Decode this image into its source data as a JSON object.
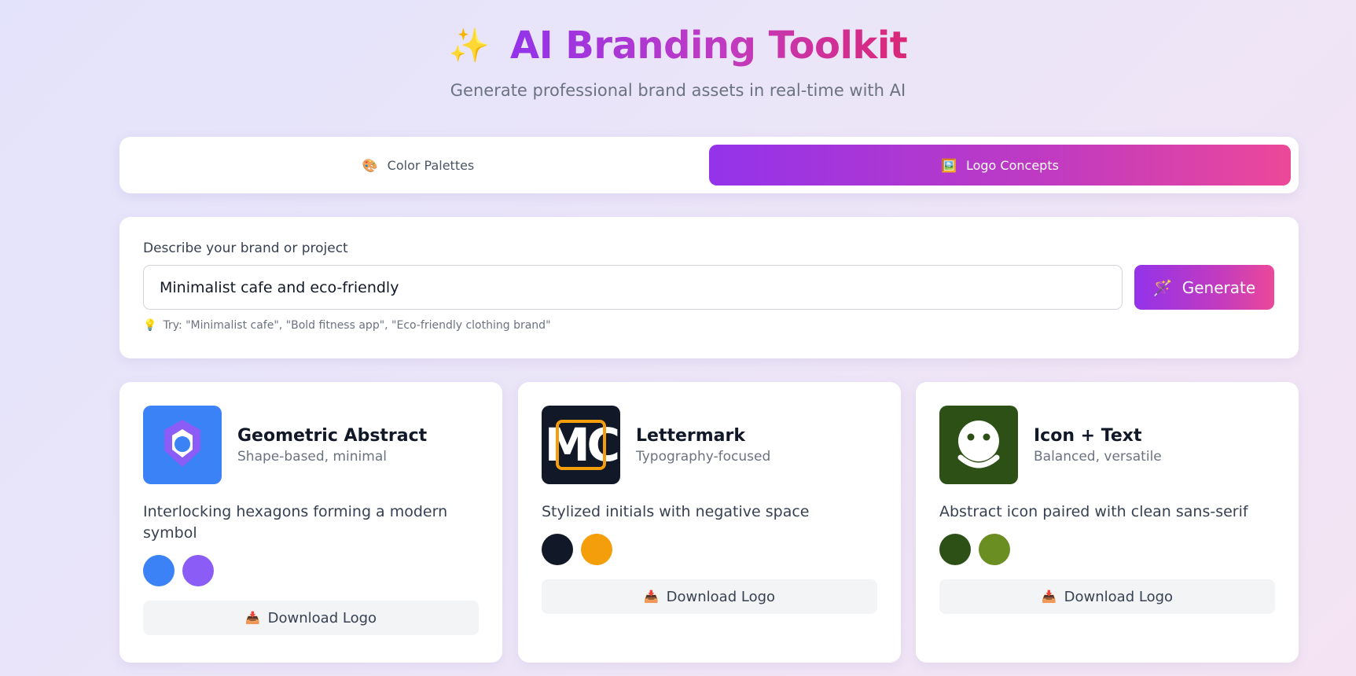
{
  "header": {
    "icon": "sparkles-icon",
    "emoji": "✨",
    "title": "AI Branding Toolkit",
    "subtitle": "Generate professional brand assets in real-time with AI"
  },
  "tabs": [
    {
      "label": "Color Palettes",
      "icon": "palette-icon",
      "emoji": "🎨",
      "active": false
    },
    {
      "label": "Logo Concepts",
      "icon": "picture-icon",
      "emoji": "🖼️",
      "active": true
    }
  ],
  "colors": {
    "accent_start": "#9333ea",
    "accent_end": "#ec4899"
  },
  "form": {
    "label": "Describe your brand or project",
    "value": "Minimalist cafe and eco-friendly",
    "generate_label": "Generate",
    "generate_emoji": "🪄",
    "hint_emoji": "💡",
    "hint": "Try: \"Minimalist cafe\", \"Bold fitness app\", \"Eco-friendly clothing brand\""
  },
  "logos": [
    {
      "title": "Geometric Abstract",
      "subtitle": "Shape-based, minimal",
      "description": "Interlocking hexagons forming a modern symbol",
      "background": "#3b82f6",
      "colors": [
        "#3b82f6",
        "#8b5cf6"
      ],
      "download_label": "Download Logo",
      "download_emoji": "📥"
    },
    {
      "title": "Lettermark",
      "subtitle": "Typography-focused",
      "description": "Stylized initials with negative space",
      "background": "#111827",
      "initials": "MC",
      "colors": [
        "#111827",
        "#f59e0b"
      ],
      "download_label": "Download Logo",
      "download_emoji": "📥"
    },
    {
      "title": "Icon + Text",
      "subtitle": "Balanced, versatile",
      "description": "Abstract icon paired with clean sans-serif",
      "background": "#2d5016",
      "colors": [
        "#2d5016",
        "#6b8e23"
      ],
      "download_label": "Download Logo",
      "download_emoji": "📥"
    }
  ]
}
